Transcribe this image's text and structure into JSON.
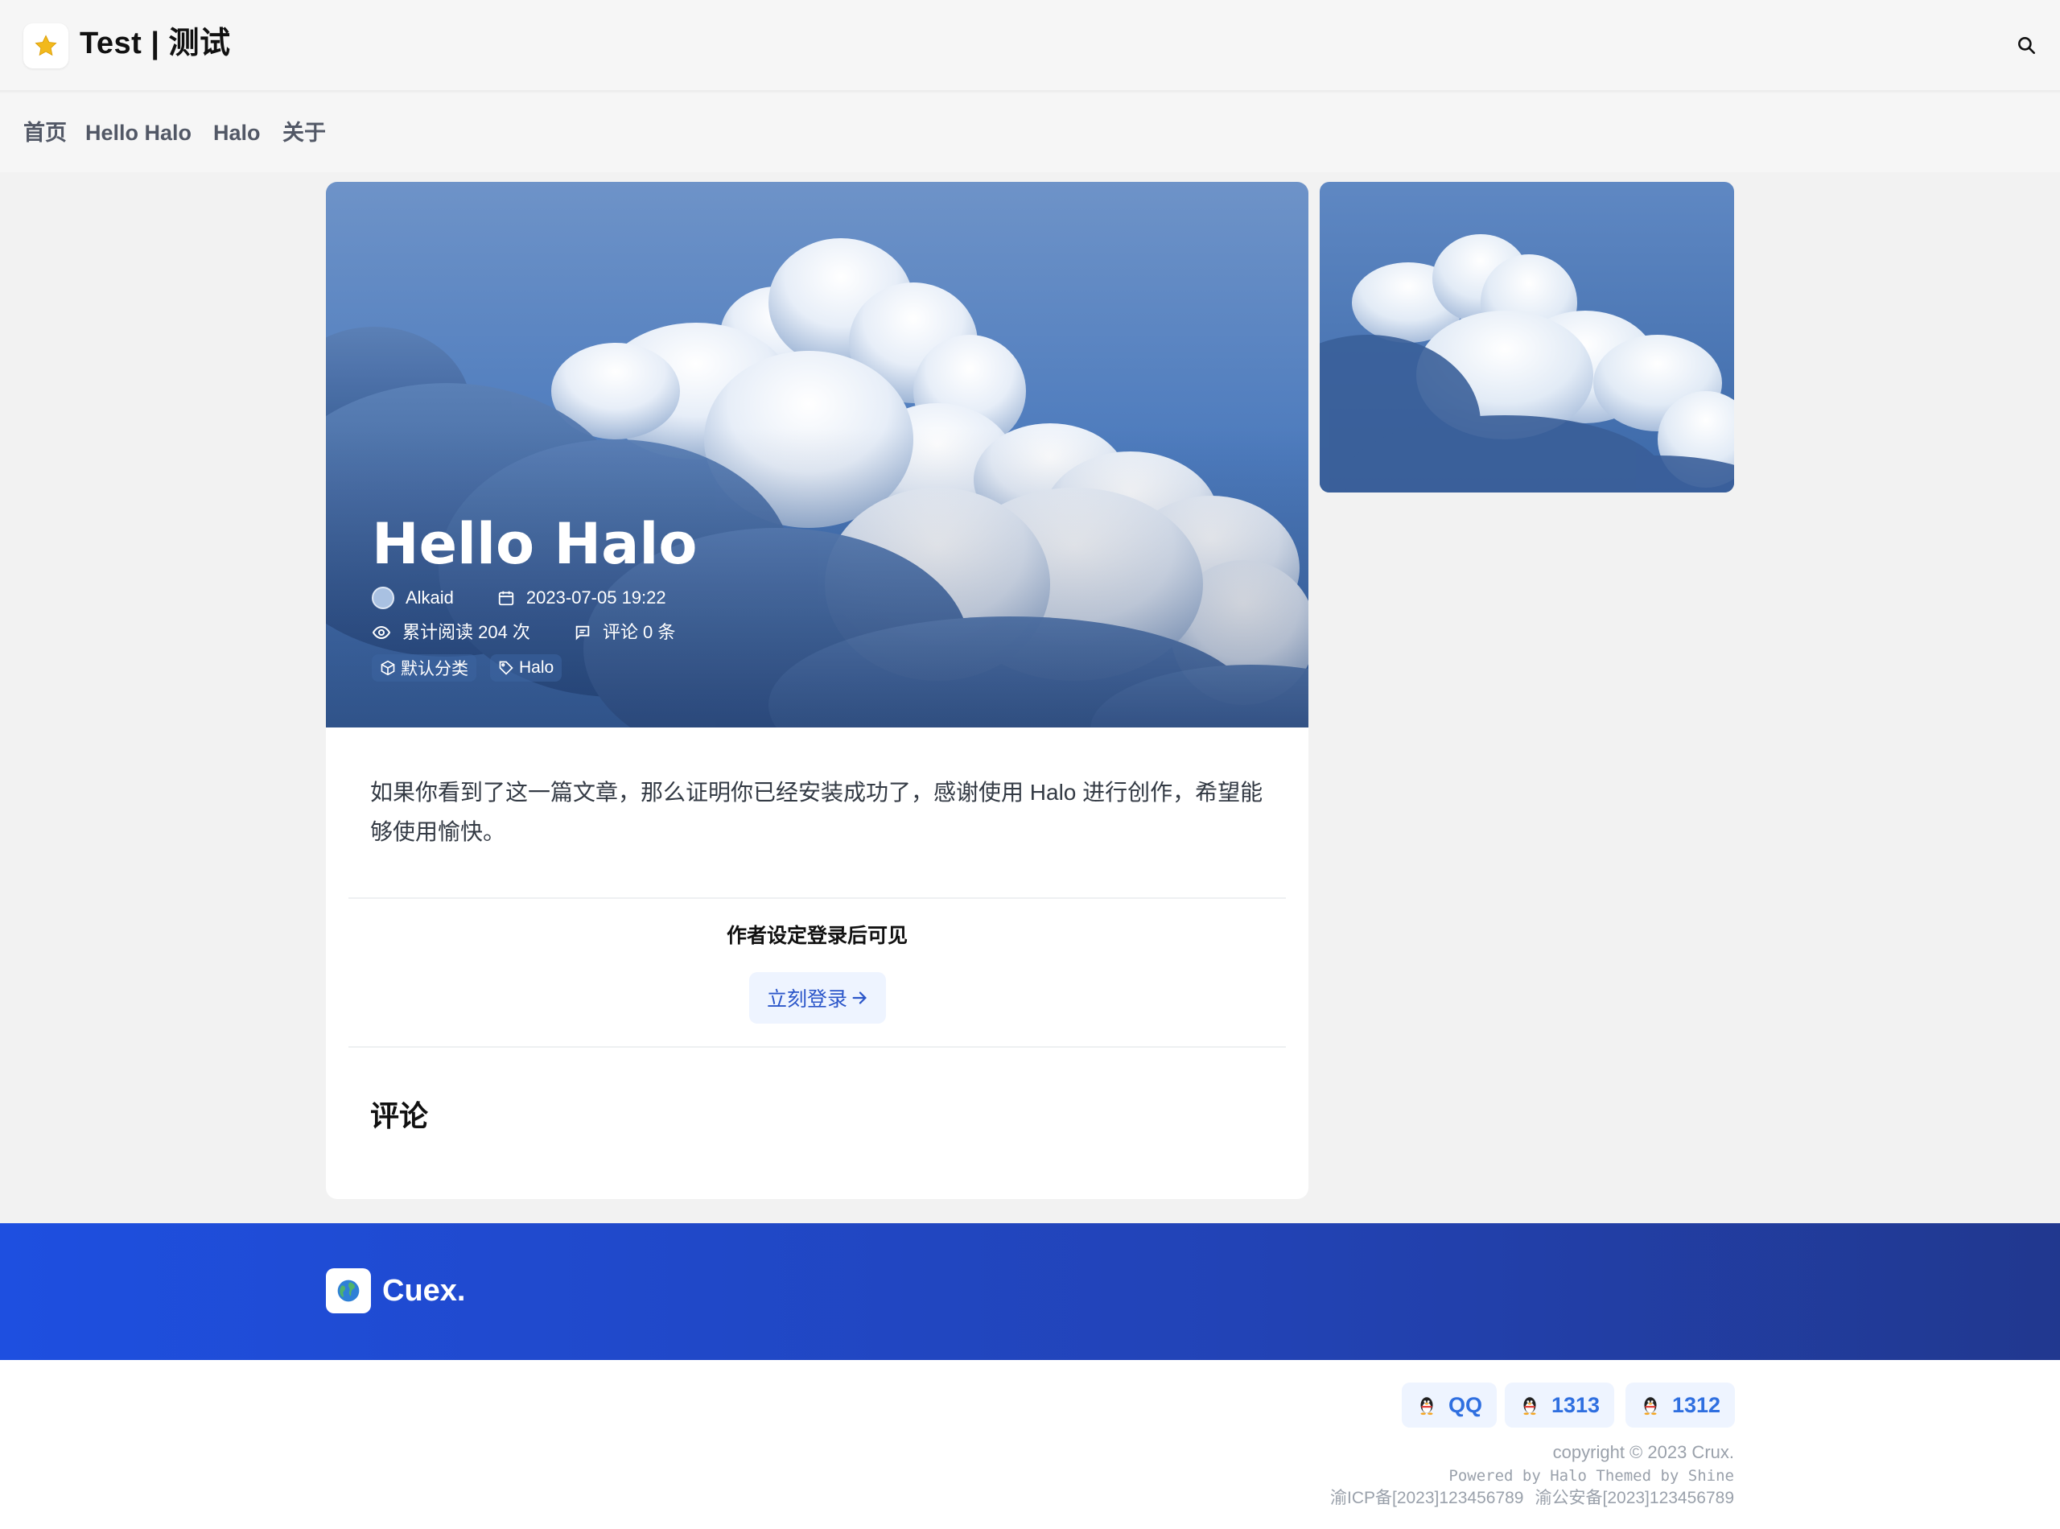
{
  "header": {
    "site_title": "Test | 测试",
    "logo_icon": "star-icon",
    "search_icon": "search-icon"
  },
  "nav": {
    "items": [
      {
        "label": "首页"
      },
      {
        "label": "Hello Halo"
      },
      {
        "label": "Halo"
      },
      {
        "label": "关于"
      }
    ]
  },
  "post": {
    "title": "Hello Halo",
    "author": "Alkaid",
    "date": "2023-07-05 19:22",
    "views": "累计阅读 204 次",
    "comments": "评论 0 条",
    "category": "默认分类",
    "tag": "Halo",
    "content": "如果你看到了这一篇文章，那么证明你已经安装成功了，感谢使用 Halo 进行创作，希望能够使用愉快。"
  },
  "login_gate": {
    "message": "作者设定登录后可见",
    "button_label": "立刻登录"
  },
  "comments_section": {
    "title": "评论"
  },
  "footer": {
    "brand": "Cuex.",
    "social": [
      {
        "label": "QQ"
      },
      {
        "label": "1313"
      },
      {
        "label": "1312"
      }
    ],
    "copyright": "copyright © 2023 Crux.",
    "powered": "Powered by Halo Themed by Shine",
    "icp": "渝ICP备[2023]123456789",
    "police": "渝公安备[2023]123456789"
  },
  "colors": {
    "accent": "#2f6fe0",
    "footer_gradient_start": "#1e4fe0",
    "footer_gradient_end": "#21388f",
    "sky": "#4f7fbf"
  }
}
